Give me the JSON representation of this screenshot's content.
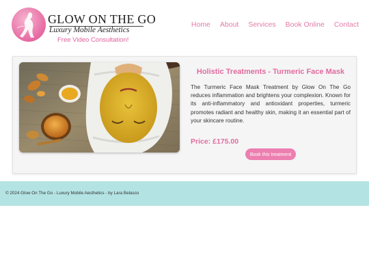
{
  "site": {
    "logo_title": "GLOW ON THE GO",
    "logo_subtitle": "Luxury Mobile Aesthetics",
    "logo_cta": "Free Video Consultation!"
  },
  "nav": {
    "items": [
      {
        "label": "Home"
      },
      {
        "label": "About"
      },
      {
        "label": "Services"
      },
      {
        "label": "Book Online"
      },
      {
        "label": "Contact"
      }
    ]
  },
  "treatment": {
    "title": "Holistic Treatments - Turmeric Face Mask",
    "description": "The Turmeric Face Mask Treatment by Glow On The Go reduces inflammation and brightens your complexion. Known for its anti-inflammatory and antioxidant properties, turmeric promotes radiant and healthy skin, making it an essential part of your skincare routine.",
    "price": "Price: £175.00",
    "book_label": "Book this treatment"
  },
  "footer": {
    "text": "© 2024 Glow On The Go - Luxury Mobile Aesthetics - by Lara Belasco"
  },
  "colors": {
    "accent_pink": "#e16b9f",
    "button_pink": "#ec7fb0",
    "footer_bg": "#b4e3e3"
  }
}
